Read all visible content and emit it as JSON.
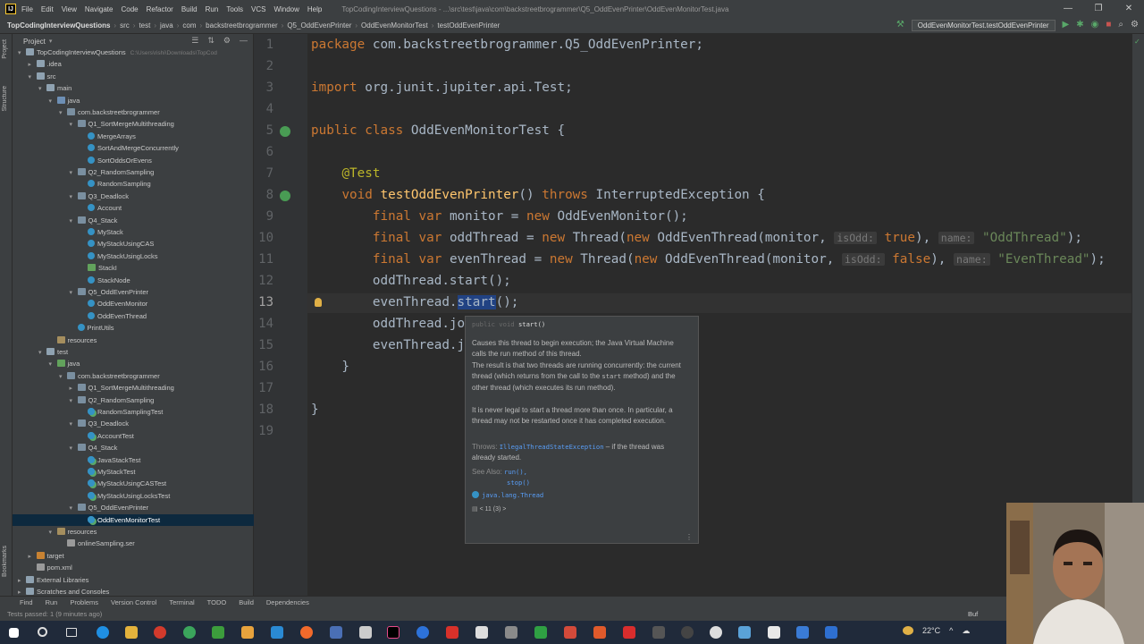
{
  "window": {
    "app_icon": "IJ",
    "title": "TopCodingInterviewQuestions - ...\\src\\test\\java\\com\\backstreetbrogrammer\\Q5_OddEvenPrinter\\OddEvenMonitorTest.java",
    "menu": [
      "File",
      "Edit",
      "View",
      "Navigate",
      "Code",
      "Refactor",
      "Build",
      "Run",
      "Tools",
      "VCS",
      "Window",
      "Help"
    ],
    "controls": [
      "—",
      "❐",
      "✕"
    ]
  },
  "breadcrumb": [
    "TopCodingInterviewQuestions",
    "src",
    "test",
    "java",
    "com",
    "backstreetbrogrammer",
    "Q5_OddEvenPrinter",
    "OddEvenMonitorTest",
    "testOddEvenPrinter"
  ],
  "run_config": "OddEvenMonitorTest.testOddEvenPrinter",
  "project_panel": {
    "title": "Project",
    "tree": [
      {
        "label": "TopCodingInterviewQuestions",
        "extra": "C:\\Users\\rishi\\Downloads\\TopCod",
        "depth": 0,
        "icon": "folder",
        "arrow": "▾"
      },
      {
        "label": ".idea",
        "depth": 1,
        "icon": "folder",
        "arrow": "▸"
      },
      {
        "label": "src",
        "depth": 1,
        "icon": "folder",
        "arrow": "▾"
      },
      {
        "label": "main",
        "depth": 2,
        "icon": "folder",
        "arrow": "▾"
      },
      {
        "label": "java",
        "depth": 3,
        "icon": "srcfolder",
        "arrow": "▾"
      },
      {
        "label": "com.backstreetbrogrammer",
        "depth": 4,
        "icon": "pkg",
        "arrow": "▾"
      },
      {
        "label": "Q1_SortMergeMultithreading",
        "depth": 5,
        "icon": "pkg",
        "arrow": "▾"
      },
      {
        "label": "MergeArrays",
        "depth": 6,
        "icon": "cls",
        "arrow": ""
      },
      {
        "label": "SortAndMergeConcurrently",
        "depth": 6,
        "icon": "cls",
        "arrow": ""
      },
      {
        "label": "SortOddsOrEvens",
        "depth": 6,
        "icon": "cls",
        "arrow": ""
      },
      {
        "label": "Q2_RandomSampling",
        "depth": 5,
        "icon": "pkg",
        "arrow": "▾"
      },
      {
        "label": "RandomSampling",
        "depth": 6,
        "icon": "cls",
        "arrow": ""
      },
      {
        "label": "Q3_Deadlock",
        "depth": 5,
        "icon": "pkg",
        "arrow": "▾"
      },
      {
        "label": "Account",
        "depth": 6,
        "icon": "cls",
        "arrow": ""
      },
      {
        "label": "Q4_Stack",
        "depth": 5,
        "icon": "pkg",
        "arrow": "▾"
      },
      {
        "label": "MyStack",
        "depth": 6,
        "icon": "cls",
        "arrow": ""
      },
      {
        "label": "MyStackUsingCAS",
        "depth": 6,
        "icon": "cls",
        "arrow": ""
      },
      {
        "label": "MyStackUsingLocks",
        "depth": 6,
        "icon": "cls",
        "arrow": ""
      },
      {
        "label": "StackI",
        "depth": 6,
        "icon": "testfolder",
        "arrow": ""
      },
      {
        "label": "StackNode",
        "depth": 6,
        "icon": "cls",
        "arrow": ""
      },
      {
        "label": "Q5_OddEvenPrinter",
        "depth": 5,
        "icon": "pkg",
        "arrow": "▾"
      },
      {
        "label": "OddEvenMonitor",
        "depth": 6,
        "icon": "cls",
        "arrow": ""
      },
      {
        "label": "OddEvenThread",
        "depth": 6,
        "icon": "cls",
        "arrow": ""
      },
      {
        "label": "PrintUtils",
        "depth": 5,
        "icon": "cls",
        "arrow": ""
      },
      {
        "label": "resources",
        "depth": 3,
        "icon": "resfolder",
        "arrow": ""
      },
      {
        "label": "test",
        "depth": 2,
        "icon": "folder",
        "arrow": "▾"
      },
      {
        "label": "java",
        "depth": 3,
        "icon": "testfolder",
        "arrow": "▾"
      },
      {
        "label": "com.backstreetbrogrammer",
        "depth": 4,
        "icon": "pkg",
        "arrow": "▾"
      },
      {
        "label": "Q1_SortMergeMultithreading",
        "depth": 5,
        "icon": "pkg",
        "arrow": "▸"
      },
      {
        "label": "Q2_RandomSampling",
        "depth": 5,
        "icon": "pkg",
        "arrow": "▾"
      },
      {
        "label": "RandomSamplingTest",
        "depth": 6,
        "icon": "testcls",
        "arrow": ""
      },
      {
        "label": "Q3_Deadlock",
        "depth": 5,
        "icon": "pkg",
        "arrow": "▾"
      },
      {
        "label": "AccountTest",
        "depth": 6,
        "icon": "testcls",
        "arrow": ""
      },
      {
        "label": "Q4_Stack",
        "depth": 5,
        "icon": "pkg",
        "arrow": "▾"
      },
      {
        "label": "JavaStackTest",
        "depth": 6,
        "icon": "testcls",
        "arrow": ""
      },
      {
        "label": "MyStackTest",
        "depth": 6,
        "icon": "testcls",
        "arrow": ""
      },
      {
        "label": "MyStackUsingCASTest",
        "depth": 6,
        "icon": "testcls",
        "arrow": ""
      },
      {
        "label": "MyStackUsingLocksTest",
        "depth": 6,
        "icon": "testcls",
        "arrow": ""
      },
      {
        "label": "Q5_OddEvenPrinter",
        "depth": 5,
        "icon": "pkg",
        "arrow": "▾"
      },
      {
        "label": "OddEvenMonitorTest",
        "depth": 6,
        "icon": "testcls",
        "arrow": "",
        "selected": true
      },
      {
        "label": "resources",
        "depth": 3,
        "icon": "resfolder",
        "arrow": "▾"
      },
      {
        "label": "onlineSampling.ser",
        "depth": 4,
        "icon": "file",
        "arrow": ""
      },
      {
        "label": "target",
        "depth": 1,
        "icon": "excl",
        "arrow": "▸"
      },
      {
        "label": "pom.xml",
        "depth": 1,
        "icon": "file",
        "arrow": ""
      },
      {
        "label": "External Libraries",
        "depth": 0,
        "icon": "folder",
        "arrow": "▸"
      },
      {
        "label": "Scratches and Consoles",
        "depth": 0,
        "icon": "folder",
        "arrow": "▸"
      }
    ]
  },
  "editor": {
    "line_numbers": [
      "1",
      "2",
      "3",
      "4",
      "5",
      "6",
      "7",
      "8",
      "9",
      "10",
      "11",
      "12",
      "13",
      "14",
      "15",
      "16",
      "17",
      "18",
      "19"
    ],
    "current_line": "13"
  },
  "doc_popup": {
    "signature_kw": "public void ",
    "signature_name": "start()",
    "para1": "Causes this thread to begin execution; the Java Virtual Machine calls the run method of this thread.",
    "para2a": "The result is that two threads are running concurrently: the current thread (which returns from the call to the ",
    "para2_code": "start",
    "para2b": " method) and the other thread (which executes its run method).",
    "para3": "It is never legal to start a thread more than once. In particular, a thread may not be restarted once it has completed execution.",
    "throws_label": "Throws:",
    "throws_link": "IllegalThreadStateException",
    "throws_text": " – if the thread was already started.",
    "see_also_label": "See Also:",
    "see_also_1": "run(),",
    "see_also_2": "stop()",
    "class_ref": "java.lang.Thread",
    "jdk": "< 11 (3) >"
  },
  "bottom_tabs": [
    "Find",
    "Run",
    "Problems",
    "Version Control",
    "Terminal",
    "TODO",
    "Build",
    "Dependencies"
  ],
  "status": {
    "message": "Tests passed: 1 (9 minutes ago)",
    "right": "Buf"
  },
  "taskbar": {
    "temperature": "22°C"
  }
}
